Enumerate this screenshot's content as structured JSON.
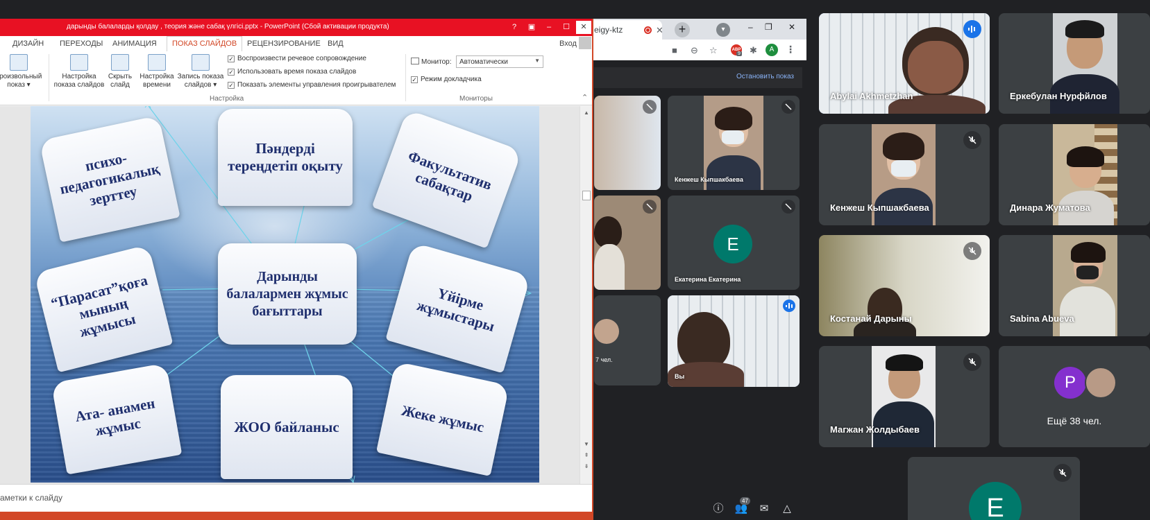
{
  "powerpoint": {
    "title": "дарынды балаларды қолдау , теория және сабақ үлгісі.pptx -  PowerPoint (Сбой активации продукта)",
    "title_buttons": [
      "?",
      "▣",
      "–",
      "☐",
      "✕"
    ],
    "tabs": [
      "ДИЗАЙН",
      "ПЕРЕХОДЫ",
      "АНИМАЦИЯ",
      "ПОКАЗ СЛАЙДОВ",
      "РЕЦЕНЗИРОВАНИЕ",
      "ВИД"
    ],
    "active_tab": "ПОКАЗ СЛАЙДОВ",
    "login": "Вход",
    "ribbon": {
      "buttons": [
        {
          "label1": "произвольный",
          "label2": "показ ▾"
        },
        {
          "label1": "Настройка",
          "label2": "показа слайдов"
        },
        {
          "label1": "Скрыть",
          "label2": "слайд"
        },
        {
          "label1": "Настройка",
          "label2": "времени"
        },
        {
          "label1": "Запись показа",
          "label2": "слайдов ▾"
        }
      ],
      "checkboxes": [
        "Воспроизвести речевое сопровождение",
        "Использовать время показа слайдов",
        "Показать элементы управления проигрывателем"
      ],
      "group_setup": "Настройка",
      "monitor_label": "Монитор:",
      "monitor_value": "Автоматически",
      "presenter_view": "Режим докладчика",
      "group_monitors": "Мониторы"
    },
    "slide": {
      "center": "Дарынды балалармен жұмыс бағыттары",
      "cards": [
        "психо-педагогикалық зерттеу",
        "Пәндерді тереңдетіп оқыту",
        "Факультатив сабақтар",
        "“Парасат”қоға мының жұмысы",
        "Үйірме жұмыстары",
        "Ата- анамен жұмыс",
        "ЖОО байланыс",
        "Жеке жұмыс"
      ]
    },
    "notes_placeholder": "аметки к слайду"
  },
  "chrome": {
    "tab_title": "eigy-ktz",
    "tab_close": "✕",
    "new_tab": "+",
    "profile_dd": "▾",
    "window_buttons": [
      "–",
      "❐",
      "✕"
    ],
    "toolbar_icons": [
      "■",
      "⊖",
      "☆",
      "✱",
      "A",
      "⋮"
    ],
    "ext_badge": "ABP",
    "ext_count": "9",
    "account_letter": "A"
  },
  "meet": {
    "stop_presenting": "Остановить показ",
    "mid_tiles": [
      {
        "name": "Кенжеш Кыпшакбаева"
      },
      {
        "name": "Екатерина Екатерина",
        "letter": "Е"
      },
      {
        "name": "Вы"
      },
      {
        "name": "7 чел."
      }
    ],
    "tiles": [
      {
        "name": "Abylai Akhmetzhan"
      },
      {
        "name": "Еркебулан Нурфйлов"
      },
      {
        "name": "Кенжеш Кыпшакбаева"
      },
      {
        "name": "Динара Жуматова"
      },
      {
        "name": "Костанай Дарыны"
      },
      {
        "name": "Sabina Abueva"
      },
      {
        "name": "Магжан Жолдыбаев"
      },
      {
        "name": "Ещё 38 чел.",
        "letter": "P"
      },
      {
        "name": "",
        "letter": "E"
      }
    ],
    "toolbar": {
      "participants_count": "47"
    },
    "colors": {
      "background": "#202124",
      "tile": "#3c4043",
      "active_border": "#8ab4f8",
      "avatar_green": "#00796b",
      "avatar_purple": "#8430ce"
    }
  }
}
